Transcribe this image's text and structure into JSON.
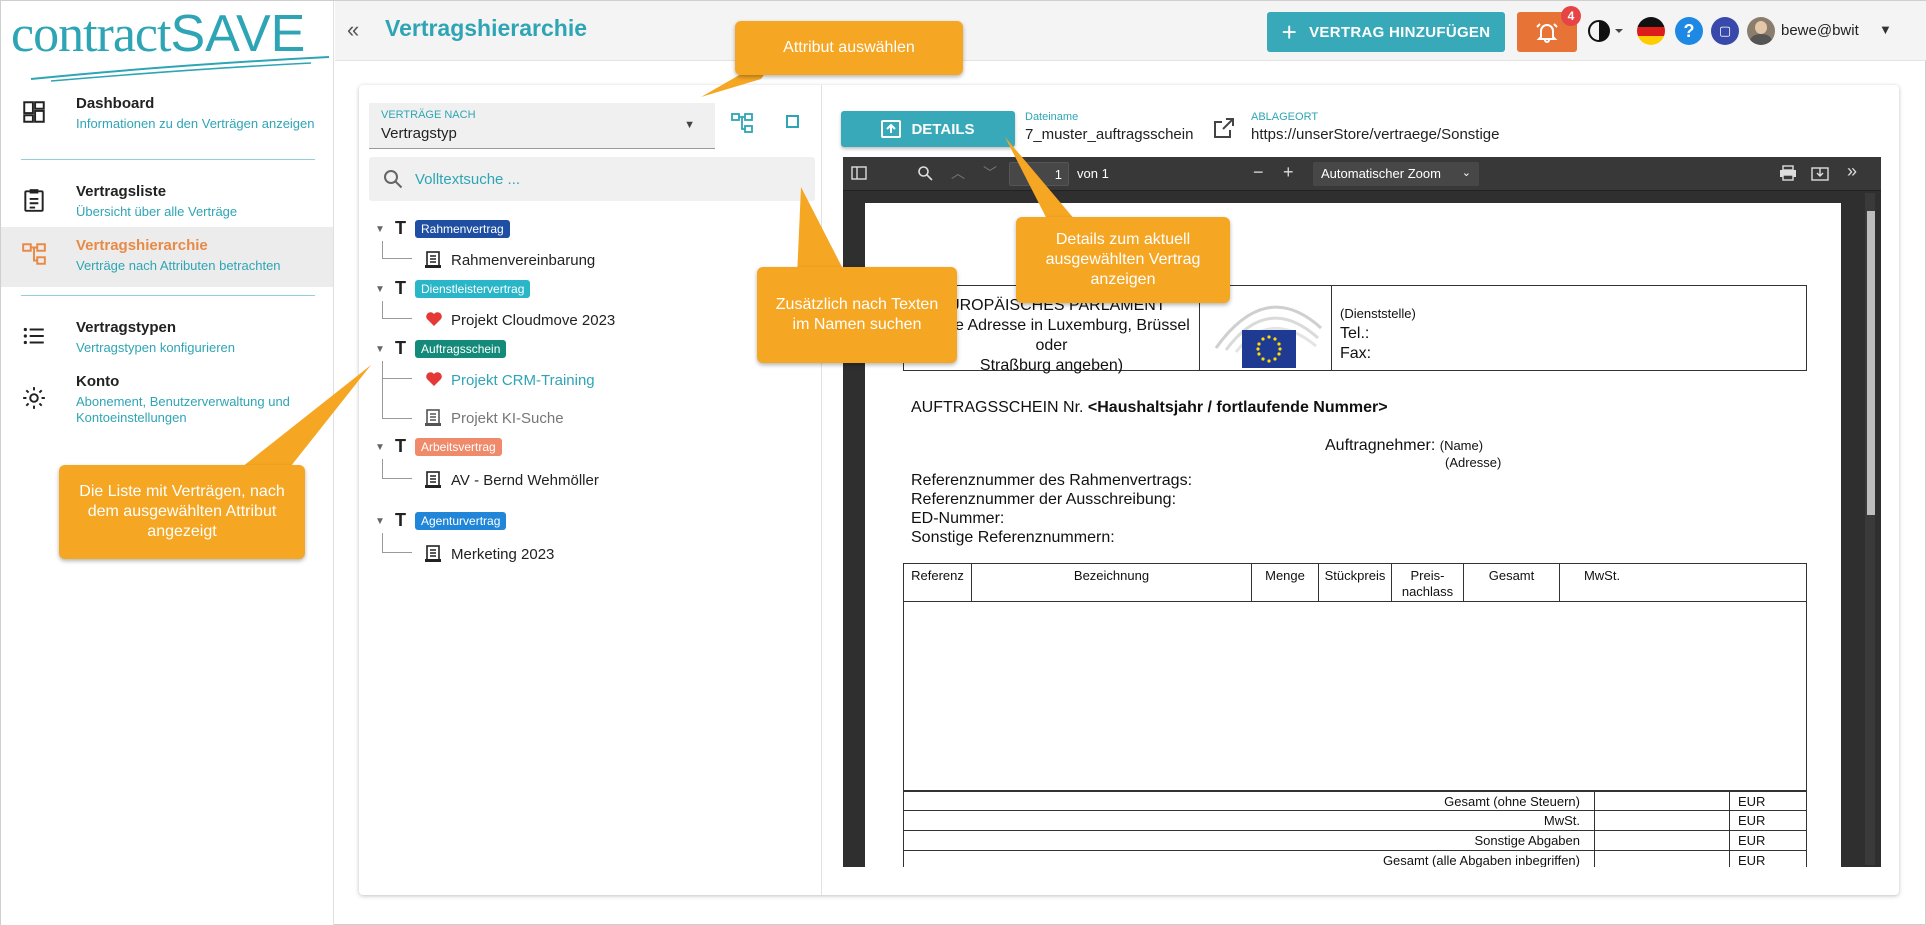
{
  "app": {
    "logo_prefix": "contract",
    "logo_suffix": "SAVE",
    "page_title": "Vertragshierarchie",
    "accent": "#2ea5b5",
    "accent_orange": "#e88a45"
  },
  "sidebar": {
    "items": [
      {
        "title": "Dashboard",
        "subtitle": "Informationen zu den Verträgen anzeigen",
        "icon": "dashboard-icon"
      },
      {
        "title": "Vertragsliste",
        "subtitle": "Übersicht über alle Verträge",
        "icon": "clipboard-list-icon"
      },
      {
        "title": "Vertragshierarchie",
        "subtitle": "Verträge nach Attributen betrachten",
        "icon": "hierarchy-icon",
        "active": true
      },
      {
        "title": "Vertragstypen",
        "subtitle": "Vertragstypen konfigurieren",
        "icon": "list-icon"
      },
      {
        "title": "Konto",
        "subtitle": "Abonement, Benutzerverwaltung und Kontoeinstellungen",
        "icon": "gear-icon"
      }
    ]
  },
  "topbar": {
    "add_button": "VERTRAG HINZUFÜGEN",
    "notification_count": "4",
    "username": "bewe@bwit"
  },
  "filter": {
    "label": "VERTRÄGE NACH",
    "value": "Vertragstyp",
    "search_placeholder": "Volltextsuche ..."
  },
  "tree": [
    {
      "badge": "Rahmenvertrag",
      "color": "#1e4fa3",
      "items": [
        {
          "label": "Rahmenvereinbarung",
          "icon": "contract-icon"
        }
      ]
    },
    {
      "badge": "Dienstleistervertrag",
      "color": "#29b6c8",
      "items": [
        {
          "label": "Projekt Cloudmove 2023",
          "icon": "heart-icon"
        }
      ]
    },
    {
      "badge": "Auftragsschein",
      "color": "#138a7a",
      "items": [
        {
          "label": "Projekt CRM-Training",
          "icon": "heart-icon",
          "selected": true
        },
        {
          "label": "Projekt KI-Suche",
          "icon": "contract-icon",
          "dim": true
        }
      ]
    },
    {
      "badge": "Arbeitsvertrag",
      "color": "#ef8a6b",
      "items": [
        {
          "label": "AV - Bernd Wehmöller",
          "icon": "contract-icon"
        }
      ]
    },
    {
      "badge": "Agenturvertrag",
      "color": "#2186d8",
      "items": [
        {
          "label": "Merketing 2023",
          "icon": "contract-icon"
        }
      ]
    }
  ],
  "details": {
    "button": "DETAILS",
    "filename_label": "Dateiname",
    "filename": "7_muster_auftragsschein",
    "location_label": "ABLAGEORT",
    "location": "https://unserStore/vertraege/Sonstige"
  },
  "viewer": {
    "page": "1",
    "of_pages": "von 1",
    "zoom": "Automatischer Zoom"
  },
  "document": {
    "org_lines": [
      "EUROPÄISCHES PARLAMENT",
      "(Reelle Adresse in Luxemburg, Brüssel oder",
      "Straßburg angeben)"
    ],
    "dienststelle": "(Dienststelle)",
    "tel": "Tel.:",
    "fax": "Fax:",
    "title_prefix": "AUFTRAGSSCHEIN Nr. ",
    "title_bold": "<Haushaltsjahr / fortlaufende Nummer>",
    "auftragnehmer": "Auftragnehmer:",
    "name": "(Name)",
    "adresse": "(Adresse)",
    "ref_lines": [
      "Referenznummer des Rahmenvertrags:",
      "Referenznummer der Ausschreibung:",
      "ED-Nummer:",
      "Sonstige Referenznummern:"
    ],
    "columns": [
      "Referenz",
      "Bezeichnung",
      "Menge",
      "Stückpreis",
      "Preis-\nnachlass",
      "Gesamt",
      "MwSt."
    ],
    "totals": [
      {
        "label": "Gesamt (ohne Steuern)",
        "cur": "EUR"
      },
      {
        "label": "MwSt.",
        "cur": "EUR"
      },
      {
        "label": "Sonstige Abgaben",
        "cur": "EUR"
      },
      {
        "label": "Gesamt (alle Abgaben inbegriffen)",
        "cur": "EUR"
      }
    ]
  },
  "callouts": {
    "attribut": "Attribut auswählen",
    "suche": "Zusätzlich nach Texten im Namen suchen",
    "details": "Details zum aktuell ausgewählten Vertrag anzeigen",
    "liste": "Die Liste mit Verträgen, nach dem ausgewählten Attribut angezeigt"
  }
}
